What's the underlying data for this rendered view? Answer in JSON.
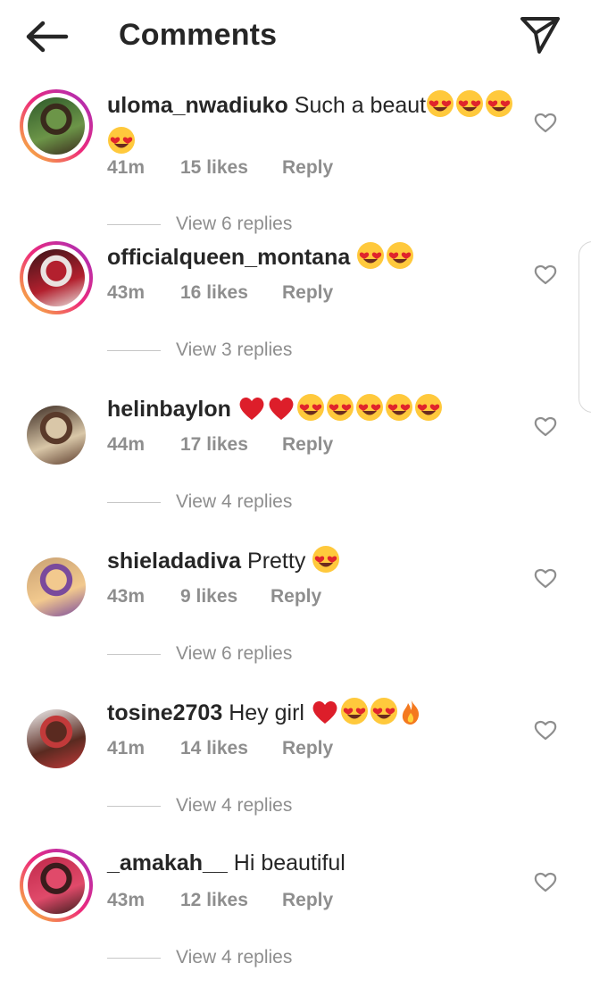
{
  "header": {
    "title": "Comments"
  },
  "comments": [
    {
      "username": "uloma_nwadiuko",
      "text": "Such a beaut",
      "emojis": [
        "heart-eyes",
        "heart-eyes",
        "heart-eyes",
        "heart-eyes"
      ],
      "time": "41m",
      "likes": "15 likes",
      "reply": "Reply",
      "view_replies": "View 6 replies",
      "story_ring": true,
      "avatar_colors": [
        "#2e5a2a",
        "#6c9548",
        "#3a2a1c"
      ]
    },
    {
      "username": "officialqueen_montana",
      "text": "",
      "emojis": [
        "heart-eyes",
        "heart-eyes"
      ],
      "time": "43m",
      "likes": "16 likes",
      "reply": "Reply",
      "view_replies": "View 3 replies",
      "story_ring": true,
      "avatar_colors": [
        "#3a1418",
        "#b3202e",
        "#e9e2e0"
      ]
    },
    {
      "username": "helinbaylon",
      "text": "",
      "emojis": [
        "red-heart",
        "red-heart",
        "heart-eyes",
        "heart-eyes",
        "heart-eyes",
        "heart-eyes",
        "heart-eyes"
      ],
      "time": "44m",
      "likes": "17 likes",
      "reply": "Reply",
      "view_replies": "View 4 replies",
      "story_ring": false,
      "avatar_colors": [
        "#3b2a22",
        "#d9c7a8",
        "#5a3a2a"
      ]
    },
    {
      "username": "shieladadiva",
      "text": "Pretty",
      "emojis": [
        "heart-eyes"
      ],
      "time": "43m",
      "likes": "9 likes",
      "reply": "Reply",
      "view_replies": "View 6 replies",
      "story_ring": false,
      "avatar_colors": [
        "#c9a173",
        "#f2c98e",
        "#7a4a9c"
      ]
    },
    {
      "username": "tosine2703",
      "text": "Hey girl",
      "emojis": [
        "red-heart",
        "heart-eyes",
        "heart-eyes",
        "fire"
      ],
      "time": "41m",
      "likes": "14 likes",
      "reply": "Reply",
      "view_replies": "View 4 replies",
      "story_ring": false,
      "avatar_colors": [
        "#f3f3f3",
        "#5a2a20",
        "#c23a3a"
      ]
    },
    {
      "username": "_amakah__",
      "text": "Hi beautiful",
      "emojis": [],
      "time": "43m",
      "likes": "12 likes",
      "reply": "Reply",
      "view_replies": "View 4 replies",
      "story_ring": true,
      "avatar_colors": [
        "#c0284a",
        "#e04a6a",
        "#3a1c1c"
      ]
    }
  ],
  "icons": {
    "back": "arrow-left-icon",
    "send": "paper-plane-icon",
    "like": "heart-outline-icon"
  },
  "colors": {
    "text": "#262626",
    "secondary": "#8e8e8e",
    "ring_gradient": [
      "#f9ce34",
      "#ee2a7b",
      "#a12fbf"
    ],
    "heart_red": "#e0242c",
    "emoji_yellow": "#ffc93c"
  }
}
